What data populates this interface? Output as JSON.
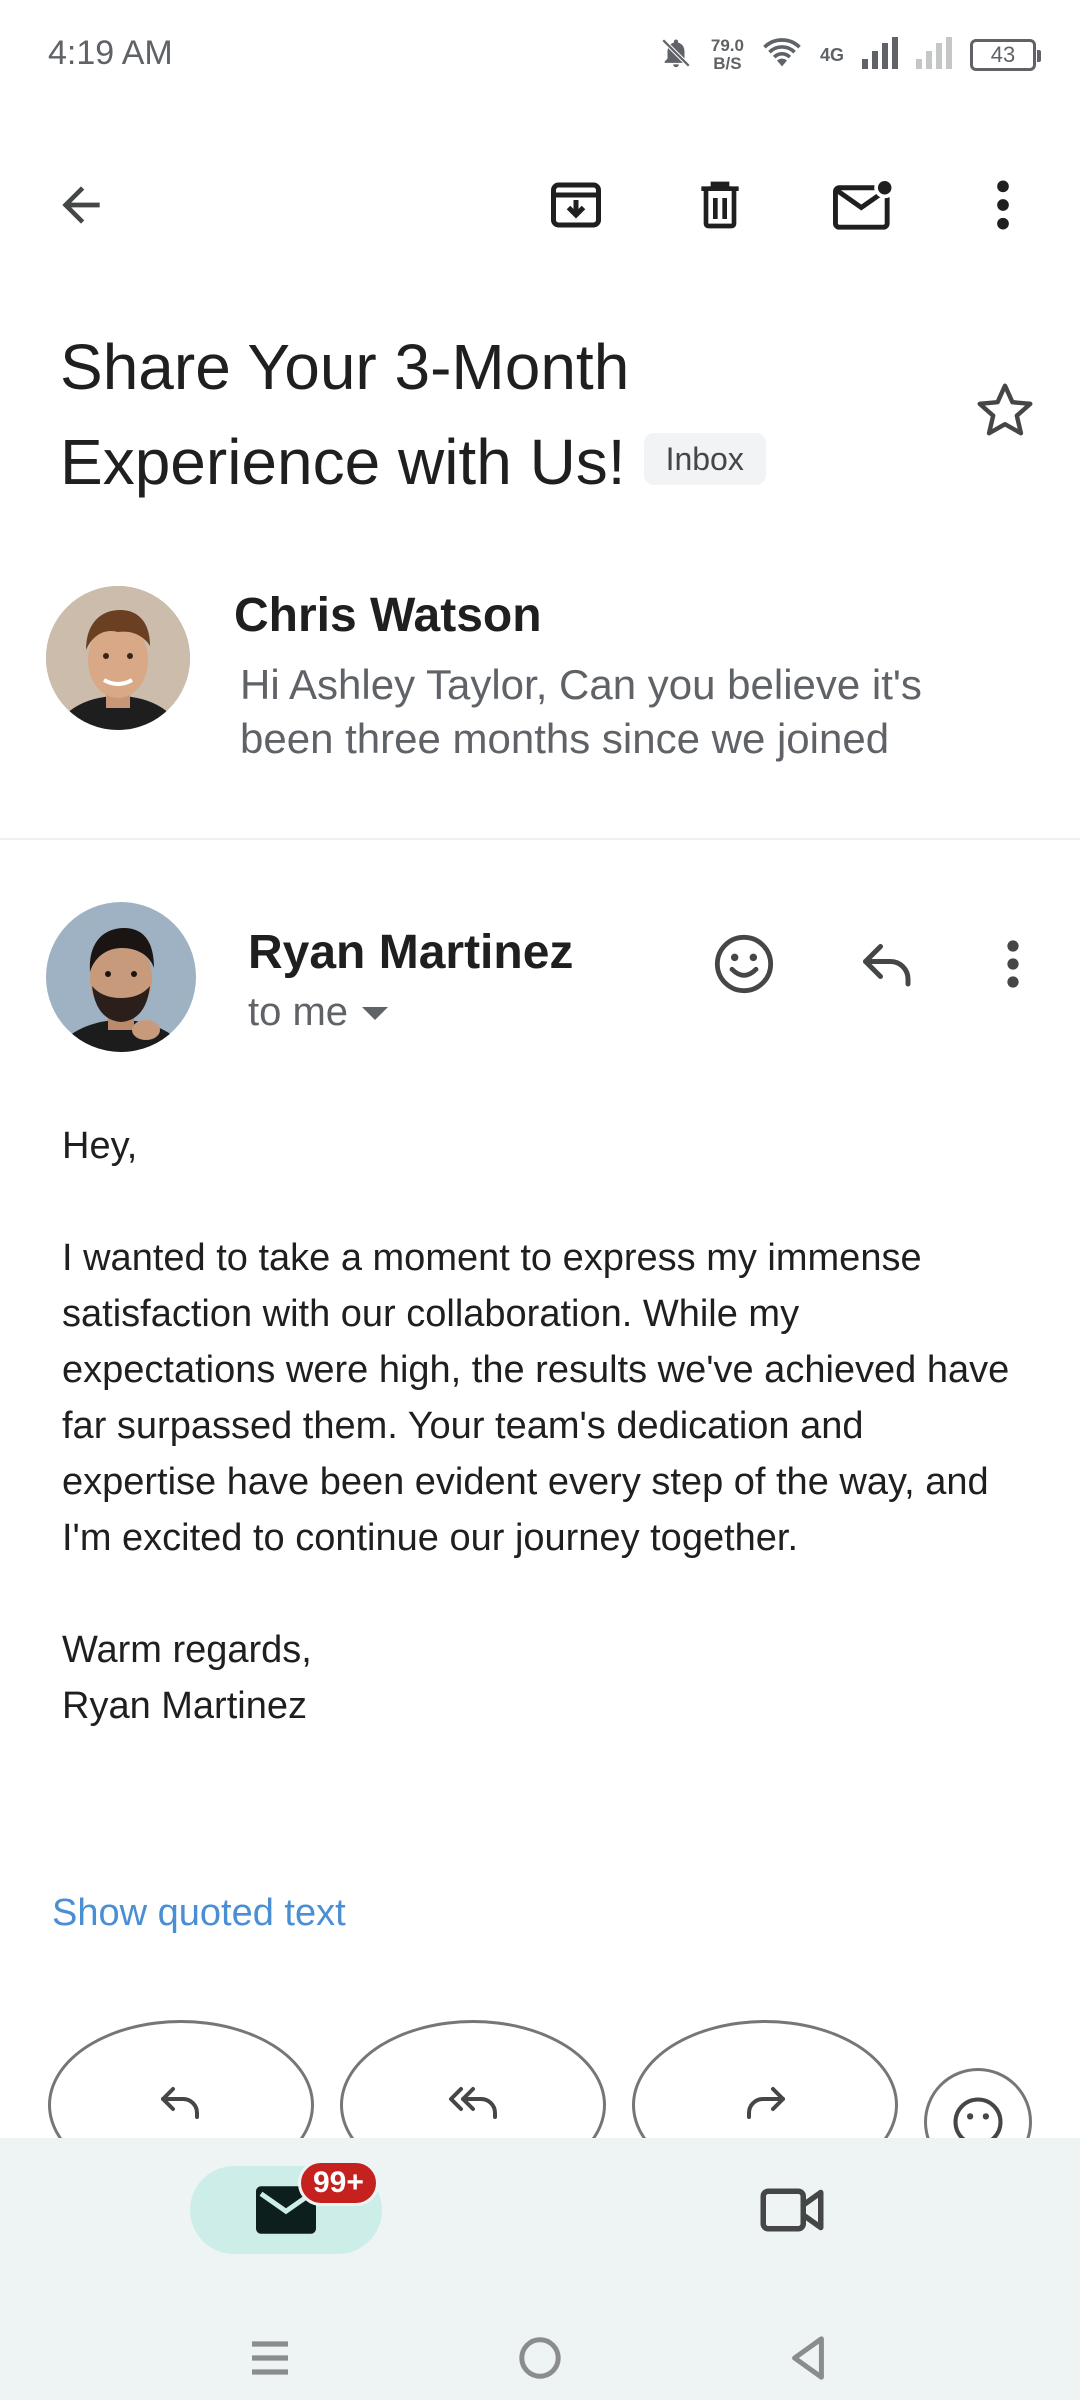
{
  "status_bar": {
    "time": "4:19 AM",
    "net_speed_value": "79.0",
    "net_speed_unit": "B/S",
    "network": "4G",
    "battery": "43"
  },
  "toolbar": {
    "icons": [
      "back-arrow-icon",
      "archive-icon",
      "delete-icon",
      "mark-unread-icon",
      "more-vert-icon"
    ]
  },
  "email": {
    "subject": "Share Your 3-Month Experience with Us!",
    "label": "Inbox"
  },
  "collapsed_message": {
    "sender": "Chris Watson",
    "snippet": "Hi Ashley Taylor, Can you believe it's been three months since we joined"
  },
  "expanded_message": {
    "sender": "Ryan Martinez",
    "recipient": "to me",
    "greeting": "Hey,",
    "paragraph": "I wanted to take a moment to express my immense satisfaction with our collaboration. While my expectations were high, the results we've achieved have far surpassed them. Your team's dedication and expertise have been evident every step of the way, and I'm excited to continue our journey together.",
    "closing": "Warm regards,",
    "signature": "Ryan Martinez",
    "show_quoted": "Show quoted text"
  },
  "bottom_nav": {
    "mail_badge": "99+"
  },
  "colors": {
    "link": "#4a8ed4",
    "badge": "#c5221f",
    "nav_bg": "#eef4f4",
    "active_pill": "#cdeee8"
  }
}
